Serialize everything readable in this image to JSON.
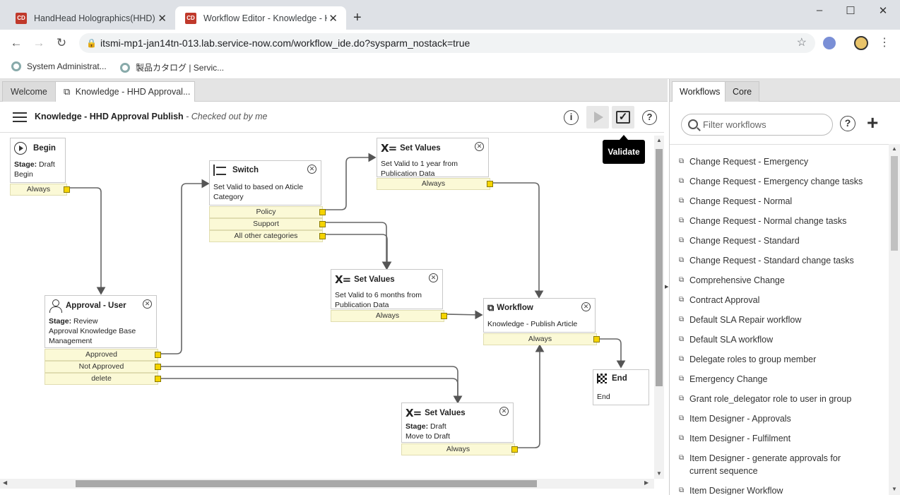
{
  "browser": {
    "tabs": [
      {
        "label": "HandHead Holographics(HHD) | ServiceNow",
        "favicon": "CD"
      },
      {
        "label": "Workflow Editor - Knowledge - HHD Approval Publish",
        "favicon": "CD"
      }
    ],
    "new_tab": "+",
    "window_controls": {
      "minimize": "–",
      "maximize": "☐",
      "close": "✕"
    },
    "url": "itsmi-mp1-jan14tn-013.lab.service-now.com/workflow_ide.do?sysparm_nostack=true",
    "bookmarks": [
      "System Administrat...",
      "製品カタログ | Servic..."
    ]
  },
  "editor": {
    "tabs": {
      "welcome": "Welcome",
      "active": "Knowledge - HHD Approval..."
    },
    "workflow_name": "Knowledge - HHD Approval Publish",
    "workflow_status": " - Checked out by me",
    "tooltip": "Validate",
    "buttons": {
      "info": "i",
      "help": "?",
      "validate": "✓"
    }
  },
  "activities": {
    "begin": {
      "title": "Begin",
      "stage_label": "Stage:",
      "stage": "Draft",
      "desc": "Begin",
      "conditions": [
        "Always"
      ]
    },
    "switch": {
      "title": "Switch",
      "desc": "Set Valid to based on Aticle Category",
      "conditions": [
        "Policy",
        "Support",
        "All other categories"
      ]
    },
    "set1": {
      "title": "Set Values",
      "desc": "Set Valid to 1 year from Publication Data",
      "conditions": [
        "Always"
      ]
    },
    "set2": {
      "title": "Set Values",
      "desc": "Set Valid to 6 months from Publication Data",
      "conditions": [
        "Always"
      ]
    },
    "approval": {
      "title": "Approval - User",
      "stage_label": "Stage:",
      "stage": "Review",
      "desc": "Approval Knowledge Base Management",
      "conditions": [
        "Approved",
        "Not Approved",
        "delete"
      ]
    },
    "workflow": {
      "title": "Workflow",
      "desc": "Knowledge - Publish Article",
      "conditions": [
        "Always"
      ]
    },
    "end": {
      "title": "End",
      "desc": "End"
    },
    "set3": {
      "title": "Set Values",
      "stage_label": "Stage:",
      "stage": "Draft",
      "desc": "Move to Draft",
      "conditions": [
        "Always"
      ]
    }
  },
  "right_panel": {
    "tabs": {
      "workflows": "Workflows",
      "core": "Core"
    },
    "filter_placeholder": "Filter workflows",
    "items": [
      "Change Request - Emergency",
      "Change Request - Emergency change tasks",
      "Change Request - Normal",
      "Change Request - Normal change tasks",
      "Change Request - Standard",
      "Change Request - Standard change tasks",
      "Comprehensive Change",
      "Contract Approval",
      "Default SLA Repair workflow",
      "Default SLA workflow",
      "Delegate roles to group member",
      "Emergency Change",
      "Grant role_delegator role to user in group",
      "Item Designer - Approvals",
      "Item Designer - Fulfilment",
      "Item Designer - generate approvals for current sequence",
      "Item Designer Workflow"
    ]
  }
}
